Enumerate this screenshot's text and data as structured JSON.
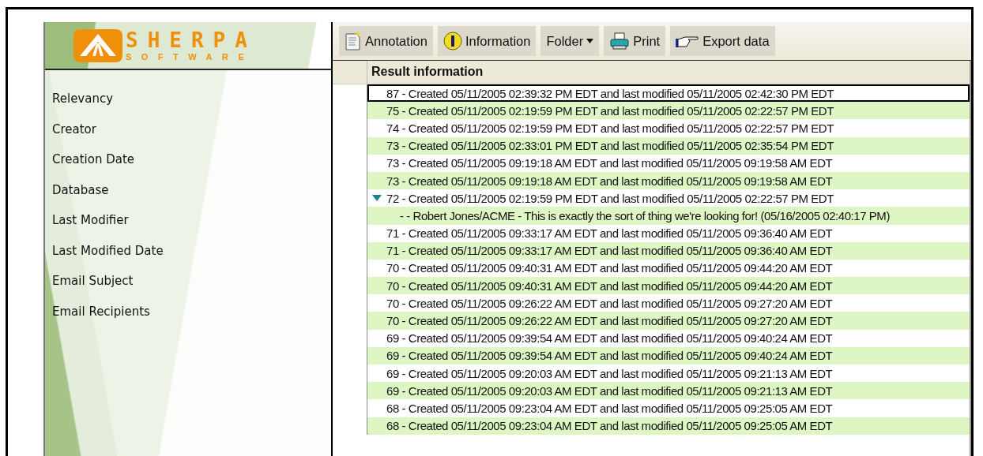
{
  "logo": {
    "name": "SHERPA",
    "tagline": "SOFTWARE"
  },
  "sidebar": {
    "items": [
      "Relevancy",
      "Creator",
      "Creation Date",
      "Database",
      "Last Modifier",
      "Last Modified Date",
      "Email Subject",
      "Email Recipients"
    ]
  },
  "toolbar": [
    {
      "label": "Annotation",
      "kind": "annotation"
    },
    {
      "label": "Information",
      "kind": "information"
    },
    {
      "label": "Folder",
      "kind": "dropdown"
    },
    {
      "label": "Print",
      "kind": "print"
    },
    {
      "label": "Export data",
      "kind": "export"
    }
  ],
  "results": {
    "header": "Result information",
    "rows": [
      {
        "kind": "result",
        "text": "87 - Created 05/11/2005 02:39:32 PM EDT and last modified 05/11/2005 02:42:30 PM EDT",
        "selected": true
      },
      {
        "kind": "result",
        "text": "75 - Created 05/11/2005 02:19:59 PM EDT and last modified 05/11/2005 02:22:57 PM EDT",
        "selected": false
      },
      {
        "kind": "result",
        "text": "74 - Created 05/11/2005 02:19:59 PM EDT and last modified 05/11/2005 02:22:57 PM EDT",
        "selected": false
      },
      {
        "kind": "result",
        "text": "73 - Created 05/11/2005 02:33:01 PM EDT and last modified 05/11/2005 02:35:54 PM EDT",
        "selected": false
      },
      {
        "kind": "result",
        "text": "73 - Created 05/11/2005 09:19:18 AM EDT and last modified 05/11/2005 09:19:58 AM EDT",
        "selected": false
      },
      {
        "kind": "result",
        "text": "73 - Created 05/11/2005 09:19:18 AM EDT and last modified 05/11/2005 09:19:58 AM EDT",
        "selected": false
      },
      {
        "kind": "result",
        "text": "72 - Created 05/11/2005 02:19:59 PM EDT and last modified 05/11/2005 02:22:57 PM EDT",
        "selected": false,
        "expanded": true
      },
      {
        "kind": "comment",
        "text": "- - Robert Jones/ACME - This is exactly the sort of thing we're looking for! (05/16/2005 02:40:17 PM)",
        "selected": false
      },
      {
        "kind": "result",
        "text": "71 - Created 05/11/2005 09:33:17 AM EDT and last modified 05/11/2005 09:36:40 AM EDT",
        "selected": false
      },
      {
        "kind": "result",
        "text": "71 - Created 05/11/2005 09:33:17 AM EDT and last modified 05/11/2005 09:36:40 AM EDT",
        "selected": false
      },
      {
        "kind": "result",
        "text": "70 - Created 05/11/2005 09:40:31 AM EDT and last modified 05/11/2005 09:44:20 AM EDT",
        "selected": false
      },
      {
        "kind": "result",
        "text": "70 - Created 05/11/2005 09:40:31 AM EDT and last modified 05/11/2005 09:44:20 AM EDT",
        "selected": false
      },
      {
        "kind": "result",
        "text": "70 - Created 05/11/2005 09:26:22 AM EDT and last modified 05/11/2005 09:27:20 AM EDT",
        "selected": false
      },
      {
        "kind": "result",
        "text": "70 - Created 05/11/2005 09:26:22 AM EDT and last modified 05/11/2005 09:27:20 AM EDT",
        "selected": false
      },
      {
        "kind": "result",
        "text": "69 - Created 05/11/2005 09:39:54 AM EDT and last modified 05/11/2005 09:40:24 AM EDT",
        "selected": false
      },
      {
        "kind": "result",
        "text": "69 - Created 05/11/2005 09:39:54 AM EDT and last modified 05/11/2005 09:40:24 AM EDT",
        "selected": false
      },
      {
        "kind": "result",
        "text": "69 - Created 05/11/2005 09:20:03 AM EDT and last modified 05/11/2005 09:21:13 AM EDT",
        "selected": false
      },
      {
        "kind": "result",
        "text": "69 - Created 05/11/2005 09:20:03 AM EDT and last modified 05/11/2005 09:21:13 AM EDT",
        "selected": false
      },
      {
        "kind": "result",
        "text": "68 - Created 05/11/2005 09:23:04 AM EDT and last modified 05/11/2005 09:25:05 AM EDT",
        "selected": false
      },
      {
        "kind": "result",
        "text": "68 - Created 05/11/2005 09:23:04 AM EDT and last modified 05/11/2005 09:25:05 AM EDT",
        "selected": false
      }
    ]
  }
}
